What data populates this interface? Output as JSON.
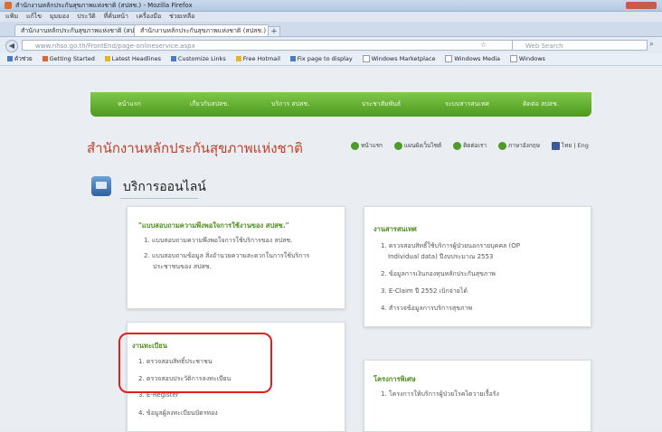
{
  "window": {
    "title": "สำนักงานหลักประกันสุขภาพแห่งชาติ (สปสช.) - Mozilla Firefox"
  },
  "menu": [
    "แฟ้ม",
    "แก้ไข",
    "มุมมอง",
    "ประวัติ",
    "ที่คั่นหน้า",
    "เครื่องมือ",
    "ช่วยเหลือ"
  ],
  "tabs": [
    "สำนักงานหลักประกันสุขภาพแห่งชาติ (สปสช.)",
    "สำนักงานหลักประกันสุขภาพแห่งชาติ (สปสช.)"
  ],
  "newtab_label": "+",
  "url": "www.nhso.go.th/FrontEnd/page-onlineservice.aspx",
  "search_placeholder": "Web Search",
  "bookmarks": [
    "ตัวช่วย",
    "Getting Started",
    "Latest Headlines",
    "Customize Links",
    "Free Hotmail",
    "Fix page to display",
    "Windows Marketplace",
    "Windows Media",
    "Windows"
  ],
  "nav": [
    "หน้าแรก",
    "เกี่ยวกับสปสช.",
    "บริการ สปสช.",
    "ประชาสัมพันธ์",
    "ระบบสารสนเทศ",
    "ติดต่อ สปสช."
  ],
  "site_title": "สำนักงานหลักประกันสุขภาพแห่งชาติ",
  "top_links": [
    "หน้าแรก",
    "แผนผังเว็บไซต์",
    "ติดต่อเรา",
    "ภาษาอังกฤษ",
    "ไทย | Eng"
  ],
  "section_title": "บริการออนไลน์",
  "box1": {
    "head": "\"แบบสอบถามความพึงพอใจการใช้งานของ สปสช.\"",
    "items": [
      "1. แบบสอบถามความพึงพอใจการใช้บริการของ สปสช.",
      "2. แบบสอบถามข้อมูล สิ่งอำนวยความสะดวกในการใช้บริการ",
      "ประชาชนของ สปสช."
    ]
  },
  "box2": {
    "head": "งานสารสนเทศ",
    "items": [
      "1. ตรวจสอบสิทธิ์ใช้บริการผู้ป่วยนอกรายบุคคล (OP",
      "Individual data) ปีงบประมาณ 2553",
      "2. ข้อมูลการเงินกองทุนหลักประกันสุขภาพ",
      "3. E-Claim ปี 2552 เบิกจ่ายได้",
      "4. สำรวจข้อมูลการบริการสุขภาพ"
    ]
  },
  "box3": {
    "head": "งานทะเบียน",
    "items": [
      "1. ตรวจสอบสิทธิ์ประชาชน",
      "2. ตรวจสอบประวัติการลงทะเบียน",
      "3. E-Register",
      "4. ข้อมูลผู้ลงทะเบียนบัตรทอง"
    ]
  },
  "box4": {
    "head": "โครงการพิเศษ",
    "items": [
      "1. โครงการให้บริการผู้ป่วยโรคไตวายเรื้อรัง"
    ]
  }
}
